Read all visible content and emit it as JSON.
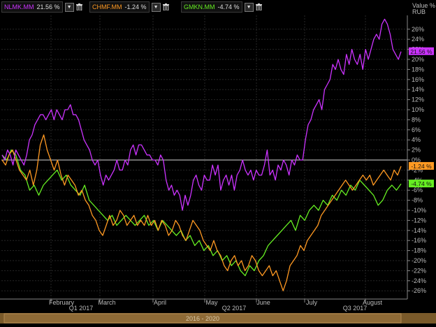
{
  "legend": [
    {
      "name": "NLMK.MM",
      "value": "21.56 %",
      "color": "#cc33ff"
    },
    {
      "name": "CHMF.MM",
      "value": "-1.24 %",
      "color": "#ff9922"
    },
    {
      "name": "GMKN.MM",
      "value": "-4.74 %",
      "color": "#66ee22"
    }
  ],
  "axis": {
    "title_line1": "Value %",
    "title_line2": "RUB"
  },
  "range_bar_label": "2016 - 2020",
  "chart_data": {
    "type": "line",
    "ylabel": "Value % RUB",
    "ylim": [
      -27,
      29
    ],
    "yticks": [
      26,
      24,
      22,
      20,
      18,
      16,
      14,
      12,
      10,
      8,
      6,
      4,
      2,
      0,
      -2,
      -4,
      -6,
      -8,
      -10,
      -12,
      -14,
      -16,
      -18,
      -20,
      -22,
      -24,
      -26
    ],
    "ytick_labels": [
      "26%",
      "24%",
      "22%",
      "20%",
      "18%",
      "16%",
      "14%",
      "12%",
      "10%",
      "8%",
      "6%",
      "4%",
      "2%",
      "0%",
      "-2%",
      "-4%",
      "-6%",
      "-8%",
      "-10%",
      "-12%",
      "-14%",
      "-16%",
      "-18%",
      "-20%",
      "-22%",
      "-24%",
      "-26%"
    ],
    "month_labels": [
      "February",
      "March",
      "April",
      "May",
      "June",
      "July",
      "August"
    ],
    "quarter_labels": [
      "Q1 2017",
      "Q2 2017",
      "Q3 2017"
    ],
    "grid": true,
    "series": [
      {
        "name": "NLMK.MM",
        "color": "#cc33ff",
        "end_label": "21.56 %",
        "values": [
          1,
          0,
          2,
          1,
          -1,
          2,
          1,
          0,
          -1,
          1,
          4,
          5,
          7,
          8,
          9,
          9,
          8,
          9,
          10,
          8,
          10,
          9,
          8,
          10,
          10,
          11,
          9,
          9,
          8,
          6,
          4,
          3,
          2,
          0,
          -1,
          0,
          -3,
          -5,
          -3,
          -4,
          -3,
          -2,
          0,
          -2,
          -2,
          0,
          -1,
          2,
          3,
          1,
          3,
          3,
          2,
          1,
          1,
          0,
          0,
          -1,
          1,
          0,
          -4,
          -6,
          -5,
          -7,
          -6,
          -7,
          -10,
          -7,
          -9,
          -7,
          -4,
          -3,
          -5,
          -6,
          -3,
          -4,
          -4,
          -1,
          -3,
          -1,
          -6,
          -4,
          -3,
          -5,
          -3,
          -6,
          -3,
          -2,
          0,
          -2,
          -3,
          -2,
          -4,
          -2,
          -3,
          -3,
          -1,
          2,
          -3,
          -2,
          -4,
          -1,
          -2,
          0,
          -1,
          -3,
          0,
          -1,
          1,
          0,
          0,
          4,
          7,
          8,
          10,
          11,
          12,
          10,
          14,
          15,
          16,
          19,
          18,
          20,
          18,
          17,
          21,
          19,
          22,
          20,
          19,
          21,
          18,
          22,
          20,
          22,
          24,
          25,
          24,
          27,
          28,
          27,
          25,
          22,
          21,
          20,
          21.56
        ]
      },
      {
        "name": "CHMF.MM",
        "color": "#ff9922",
        "end_label": "-1.24 %",
        "values": [
          0,
          -1,
          1,
          2,
          0,
          -2,
          -3,
          -4,
          -2,
          -5,
          -2,
          3,
          5,
          2,
          0,
          -2,
          0,
          -3,
          -5,
          -3,
          -4,
          -5,
          -7,
          -6,
          -8,
          -9,
          -11,
          -12,
          -14,
          -15,
          -13,
          -11,
          -13,
          -12,
          -10,
          -11,
          -13,
          -12,
          -11,
          -13,
          -12,
          -13,
          -11,
          -13,
          -12,
          -14,
          -12,
          -13,
          -15,
          -14,
          -12,
          -13,
          -15,
          -16,
          -14,
          -12,
          -13,
          -14,
          -16,
          -17,
          -18,
          -16,
          -18,
          -19,
          -21,
          -22,
          -20,
          -19,
          -21,
          -20,
          -22,
          -21,
          -19,
          -20,
          -22,
          -23,
          -22,
          -21,
          -23,
          -22,
          -24,
          -26,
          -24,
          -21,
          -20,
          -19,
          -17,
          -18,
          -16,
          -15,
          -14,
          -13,
          -11,
          -10,
          -9,
          -8,
          -7,
          -6,
          -5,
          -4,
          -5,
          -6,
          -5,
          -4,
          -3,
          -4,
          -3,
          -5,
          -4,
          -3,
          -2,
          -3,
          -4,
          -2,
          -3,
          -1.24
        ]
      },
      {
        "name": "GMKN.MM",
        "color": "#66ee22",
        "end_label": "-4.74 %",
        "values": [
          1,
          0,
          2,
          1,
          -2,
          -3,
          -6,
          -5,
          -7,
          -5,
          -4,
          -3,
          -2,
          -4,
          -3,
          -5,
          -6,
          -7,
          -5,
          -8,
          -9,
          -10,
          -11,
          -12,
          -11,
          -13,
          -12,
          -11,
          -12,
          -13,
          -12,
          -11,
          -13,
          -12,
          -14,
          -12,
          -13,
          -14,
          -15,
          -14,
          -16,
          -15,
          -17,
          -16,
          -18,
          -17,
          -19,
          -18,
          -20,
          -19,
          -21,
          -20,
          -22,
          -23,
          -21,
          -22,
          -20,
          -19,
          -17,
          -16,
          -15,
          -14,
          -13,
          -12,
          -14,
          -11,
          -12,
          -10,
          -9,
          -10,
          -8,
          -9,
          -7,
          -8,
          -6,
          -7,
          -5,
          -6,
          -4,
          -5,
          -6,
          -7,
          -9,
          -8,
          -6,
          -5,
          -6,
          -4.74
        ]
      }
    ]
  }
}
